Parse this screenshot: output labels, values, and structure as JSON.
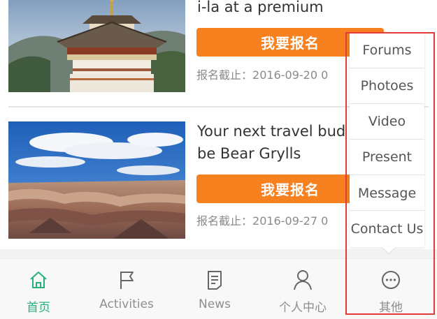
{
  "feed": {
    "items": [
      {
        "title": "i-la at a premium",
        "button_label": "我要报名",
        "deadline_label": "报名截止：",
        "deadline_value": "2016-09-20 0",
        "image": "pagoda-photo"
      },
      {
        "title_line1": "Your next travel bud",
        "title_line2": "be Bear Grylls",
        "button_label": "我要报名",
        "deadline_label": "报名截止：",
        "deadline_value": "2016-09-27 0",
        "image": "canyon-photo"
      }
    ]
  },
  "popup_menu": {
    "items": [
      "Forums",
      "Photoes",
      "Video",
      "Present",
      "Message",
      "Contact Us"
    ]
  },
  "tabbar": {
    "tabs": [
      {
        "label": "首页",
        "icon": "home-icon",
        "active": true
      },
      {
        "label": "Activities",
        "icon": "flag-icon",
        "active": false
      },
      {
        "label": "News",
        "icon": "document-icon",
        "active": false
      },
      {
        "label": "个人中心",
        "icon": "person-icon",
        "active": false
      },
      {
        "label": "其他",
        "icon": "more-icon",
        "active": false
      }
    ]
  },
  "colors": {
    "accent_orange": "#f7811f",
    "active_green": "#23b37a",
    "highlight_red": "#e33a3a",
    "inactive_gray": "#8e8e8e"
  }
}
